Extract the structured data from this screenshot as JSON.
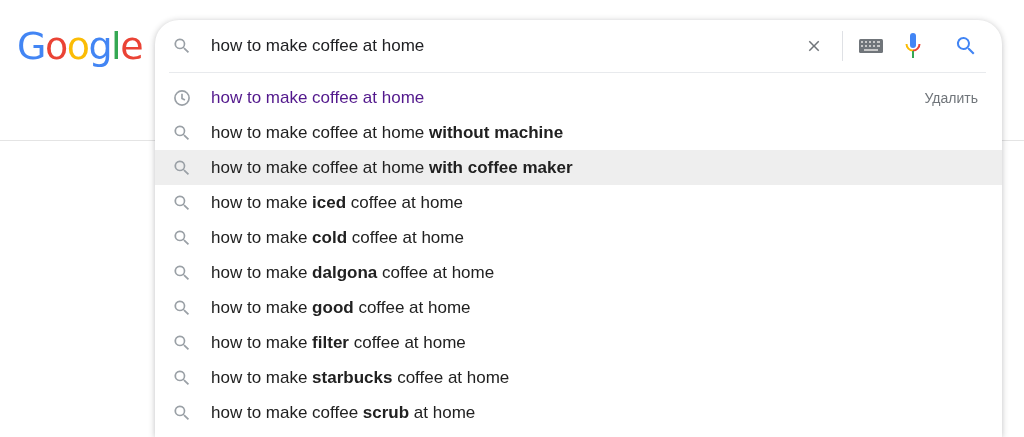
{
  "logo": "Google",
  "search": {
    "value": "how to make coffee at home"
  },
  "suggestions": [
    {
      "kind": "history",
      "text": "how to make coffee at home",
      "remove": "Удалить",
      "selected": false
    },
    {
      "kind": "search",
      "text": "how to make coffee at home **without machine**",
      "selected": false
    },
    {
      "kind": "search",
      "text": "how to make coffee at home **with coffee maker**",
      "selected": true
    },
    {
      "kind": "search",
      "text": "how to make **iced** coffee at home",
      "selected": false
    },
    {
      "kind": "search",
      "text": "how to make **cold** coffee at home",
      "selected": false
    },
    {
      "kind": "search",
      "text": "how to make **dalgona** coffee at home",
      "selected": false
    },
    {
      "kind": "search",
      "text": "how to make **good** coffee at home",
      "selected": false
    },
    {
      "kind": "search",
      "text": "how to make **filter** coffee at home",
      "selected": false
    },
    {
      "kind": "search",
      "text": "how to make **starbucks** coffee at home",
      "selected": false
    },
    {
      "kind": "search",
      "text": "how to make coffee **scrub** at home",
      "selected": false
    }
  ]
}
